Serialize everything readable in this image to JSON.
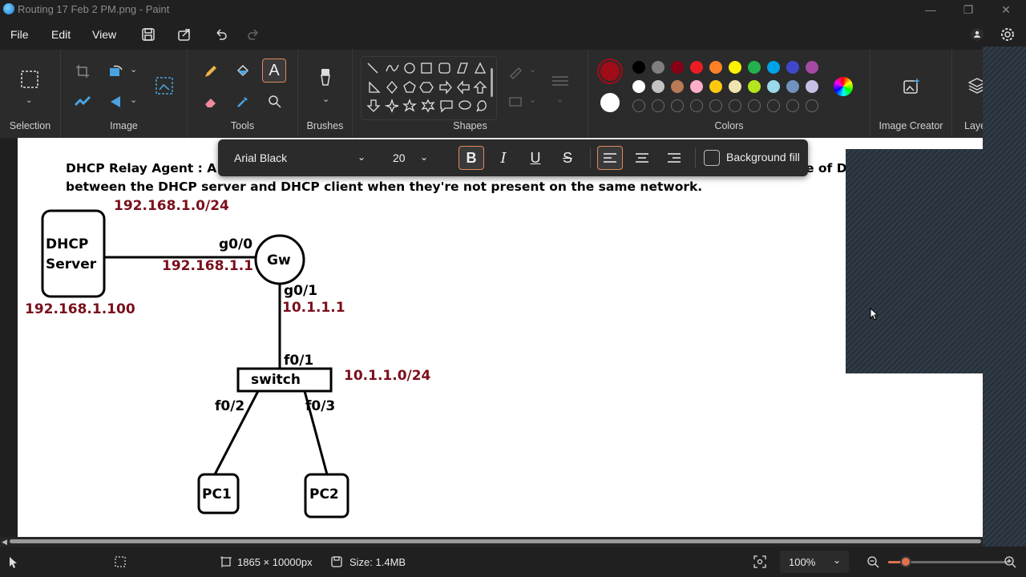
{
  "window": {
    "title": "Routing 17 Feb 2 PM.png - Paint",
    "minimize": "—",
    "maximize": "❐",
    "close": "✕"
  },
  "menu": {
    "file": "File",
    "edit": "Edit",
    "view": "View"
  },
  "ribbon": {
    "groups": {
      "selection": "Selection",
      "image": "Image",
      "tools": "Tools",
      "brushes": "Brushes",
      "shapes": "Shapes",
      "colors": "Colors",
      "image_creator": "Image Creator",
      "layers": "Laye"
    },
    "primary_color": "#a00c18",
    "secondary_color": "#ffffff",
    "palette_row1": [
      "#000000",
      "#7f7f7f",
      "#880015",
      "#ed1c24",
      "#ff7f27",
      "#fff200",
      "#22b14c",
      "#00a2e8",
      "#3f48cc",
      "#a349a4"
    ],
    "palette_row2": [
      "#ffffff",
      "#c3c3c3",
      "#b97a57",
      "#ffaec9",
      "#ffc90e",
      "#efe4b0",
      "#b5e61d",
      "#99d9ea",
      "#7092be",
      "#c8bfe7"
    ]
  },
  "text_toolbar": {
    "font": "Arial Black",
    "size": "20",
    "bold": "B",
    "italic": "I",
    "underline": "U",
    "strike": "S",
    "background_fill": "Background fill"
  },
  "document": {
    "heading_line1": "DHCP Relay Agent : A",
    "heading_line1_right": "e of D",
    "heading_line2": "between the DHCP server and DHCP client when they're not present on the same network.",
    "dhcp_server_line1": "DHCP",
    "dhcp_server_line2": "Server",
    "net1": "192.168.1.0/24",
    "server_ip": "192.168.1.100",
    "g0_0": "g0/0",
    "gw_ip1": "192.168.1.1",
    "gw": "Gw",
    "g0_1": "g0/1",
    "gw_ip2": "10.1.1.1",
    "f0_1": "f0/1",
    "switch": "switch",
    "net2": "10.1.1.0/24",
    "f0_2": "f0/2",
    "f0_3": "f0/3",
    "pc1": "PC1",
    "pc2": "PC2"
  },
  "status": {
    "dimensions": "1865 × 10000px",
    "size": "Size: 1.4MB",
    "zoom": "100%"
  }
}
